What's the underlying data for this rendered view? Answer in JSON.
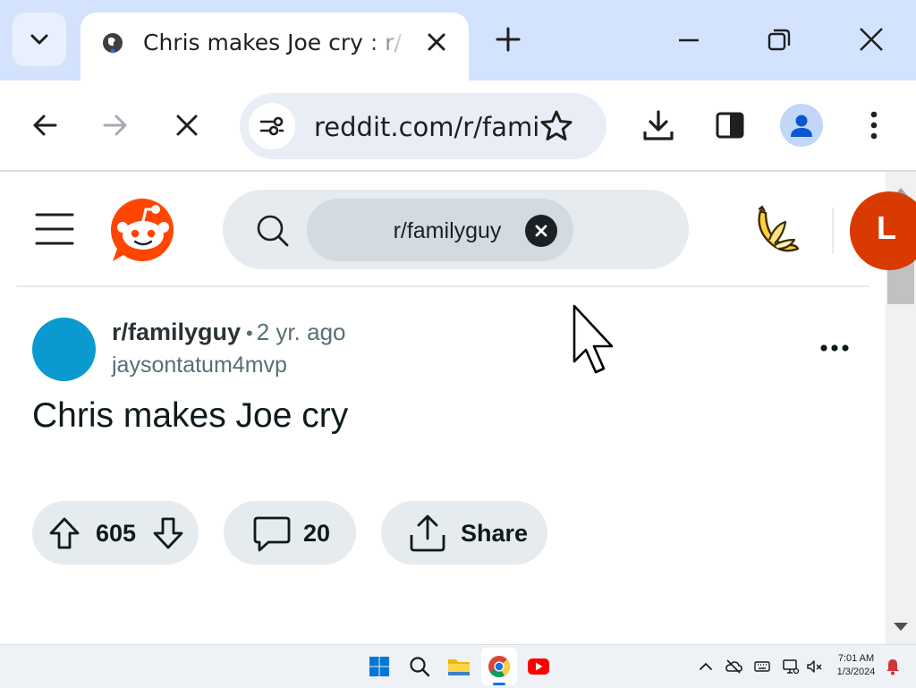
{
  "browser": {
    "tab": {
      "title": "Chris makes Joe cry : r/familyguy"
    },
    "omnibox": {
      "url": "reddit.com/r/familyguy/comments"
    }
  },
  "reddit": {
    "search": {
      "chip_label": "r/familyguy"
    },
    "user_avatar_initial": "L"
  },
  "post": {
    "subreddit": "r/familyguy",
    "separator": "•",
    "age": "2 yr. ago",
    "author": "jaysontatum4mvp",
    "title": "Chris makes Joe cry",
    "votes": "605",
    "comments": "20",
    "share_label": "Share"
  },
  "taskbar": {
    "time": "7:01 AM",
    "date": "1/3/2024"
  },
  "colors": {
    "tabstrip": "#d3e3fd",
    "reddit_orange": "#ff4500",
    "subreddit_avatar": "#0a9ad0",
    "pill_bg": "#e5ebee",
    "user_avatar": "#d93a00"
  },
  "icons": [
    "tab-search-icon",
    "globe-favicon-icon",
    "tab-close-icon",
    "new-tab-icon",
    "minimize-icon",
    "restore-icon",
    "window-close-icon",
    "back-icon",
    "forward-icon",
    "stop-loading-icon",
    "site-info-icon",
    "bookmark-star-icon",
    "download-icon",
    "side-panel-icon",
    "profile-icon",
    "chrome-menu-icon",
    "hamburger-menu-icon",
    "reddit-logo-icon",
    "search-icon",
    "clear-icon",
    "banana-icon",
    "more-options-icon",
    "upvote-icon",
    "downvote-icon",
    "comment-icon",
    "share-icon",
    "mouse-cursor-icon"
  ]
}
